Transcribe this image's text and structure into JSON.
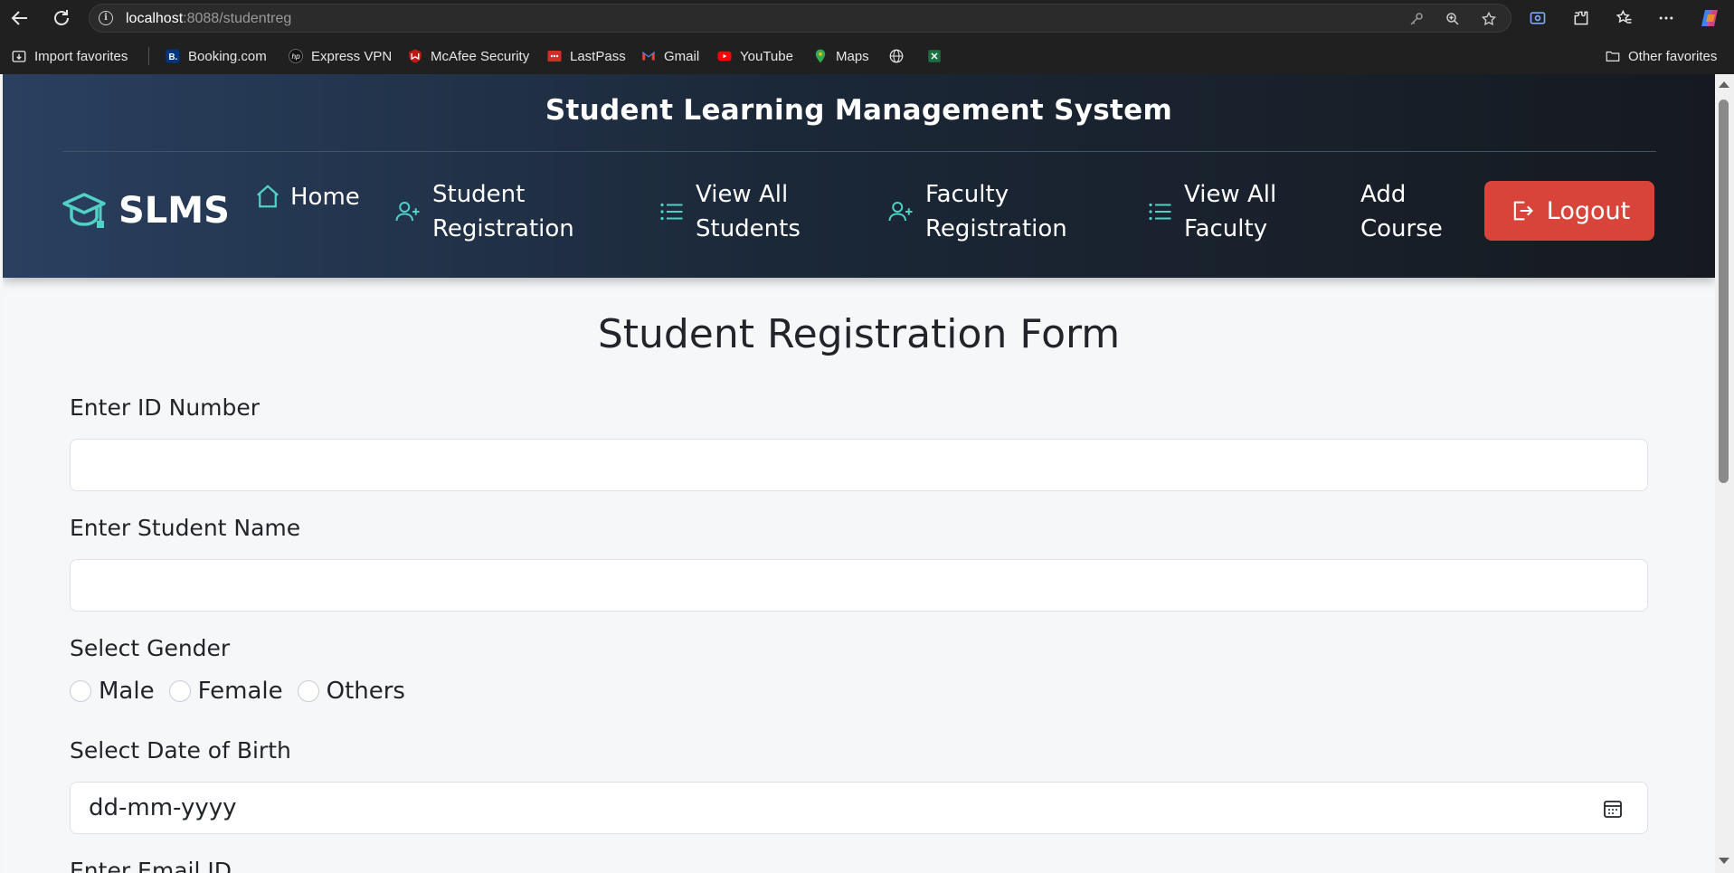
{
  "browser": {
    "url_host": "localhost",
    "url_rest": ":8088/studentreg",
    "bookmarks": [
      {
        "label": "Import favorites",
        "icon": "import-icon"
      },
      {
        "label": "Booking.com",
        "icon": "booking-icon"
      },
      {
        "label": "Express VPN",
        "icon": "hp-icon"
      },
      {
        "label": "McAfee Security",
        "icon": "mcafee-icon"
      },
      {
        "label": "LastPass",
        "icon": "lastpass-icon"
      },
      {
        "label": "Gmail",
        "icon": "gmail-icon"
      },
      {
        "label": "YouTube",
        "icon": "youtube-icon"
      },
      {
        "label": "Maps",
        "icon": "maps-icon"
      }
    ],
    "other_favorites": "Other favorites"
  },
  "header": {
    "title": "Student Learning Management System",
    "brand": "SLMS",
    "nav": {
      "home": "Home",
      "student_reg_1": "Student",
      "student_reg_2": "Registration",
      "view_students_1": "View All",
      "view_students_2": "Students",
      "faculty_reg_1": "Faculty",
      "faculty_reg_2": "Registration",
      "view_faculty_1": "View All",
      "view_faculty_2": "Faculty",
      "add_course_1": "Add",
      "add_course_2": "Course"
    },
    "logout": "Logout"
  },
  "form": {
    "title": "Student Registration Form",
    "id_label": "Enter ID Number",
    "name_label": "Enter Student Name",
    "gender_label": "Select Gender",
    "gender_options": {
      "male": "Male",
      "female": "Female",
      "others": "Others"
    },
    "dob_label": "Select Date of Birth",
    "dob_placeholder": "dd-mm-yyyy",
    "email_label": "Enter Email ID"
  },
  "colors": {
    "accent": "#4fd1c5",
    "logout": "#d9443a"
  }
}
